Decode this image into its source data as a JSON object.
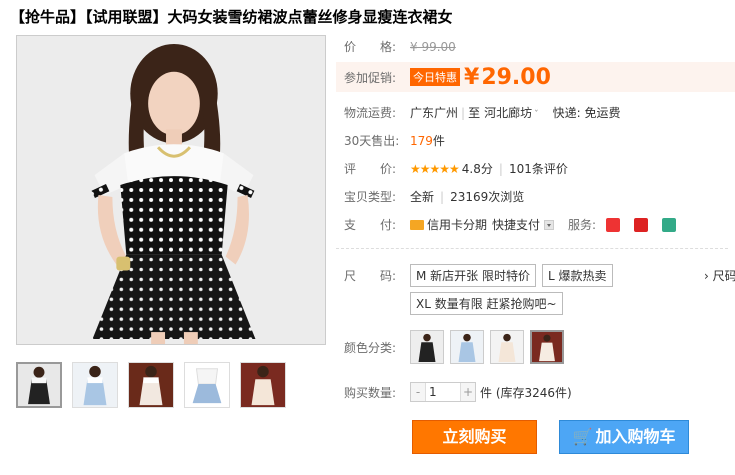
{
  "title": "【抢牛品】【试用联盟】大码女装雪纺裙波点蕾丝修身显瘦连衣裙女",
  "price": {
    "label": "价　　格:",
    "value": "¥ 99.00"
  },
  "promo": {
    "label": "参加促销:",
    "badge": "今日特惠",
    "currency": "¥",
    "value": "29.00"
  },
  "shipping": {
    "label": "物流运费:",
    "from": "广东广州",
    "to_word": "至",
    "to": "河北廊坊",
    "fee": "快递: 免运费"
  },
  "sales": {
    "label": "30天售出:",
    "count": "179",
    "unit": "件"
  },
  "rating": {
    "label": "评　　价:",
    "stars": "★★★★★",
    "score": "4.8分",
    "reviews": "101条评价"
  },
  "item_type": {
    "label": "宝贝类型:",
    "condition": "全新",
    "views": "23169次浏览"
  },
  "payment": {
    "label": "支　　付:",
    "credit": "信用卡分期",
    "quick": "快捷支付",
    "service_label": "服务:",
    "service_icons": [
      "7day-return-icon",
      "authentic-icon",
      "invoice-icon"
    ]
  },
  "size": {
    "label": "尺　　码:",
    "options": [
      "M 新店开张 限时特价",
      "L 爆款热卖",
      "XL 数量有限 赶紧抢购吧~"
    ],
    "more": "› 尺码"
  },
  "color": {
    "label": "颜色分类:",
    "selected_index": 3
  },
  "quantity": {
    "label": "购买数量:",
    "minus": "-",
    "value": "1",
    "plus": "+",
    "unit_stock": "件 (库存3246件)"
  },
  "buttons": {
    "buy": "立刻购买",
    "cart_icon": "🛒",
    "cart": "加入购物车"
  },
  "colors": {
    "accent": "#ff6600",
    "buy": "#ff7700",
    "cart": "#4da6f5"
  }
}
